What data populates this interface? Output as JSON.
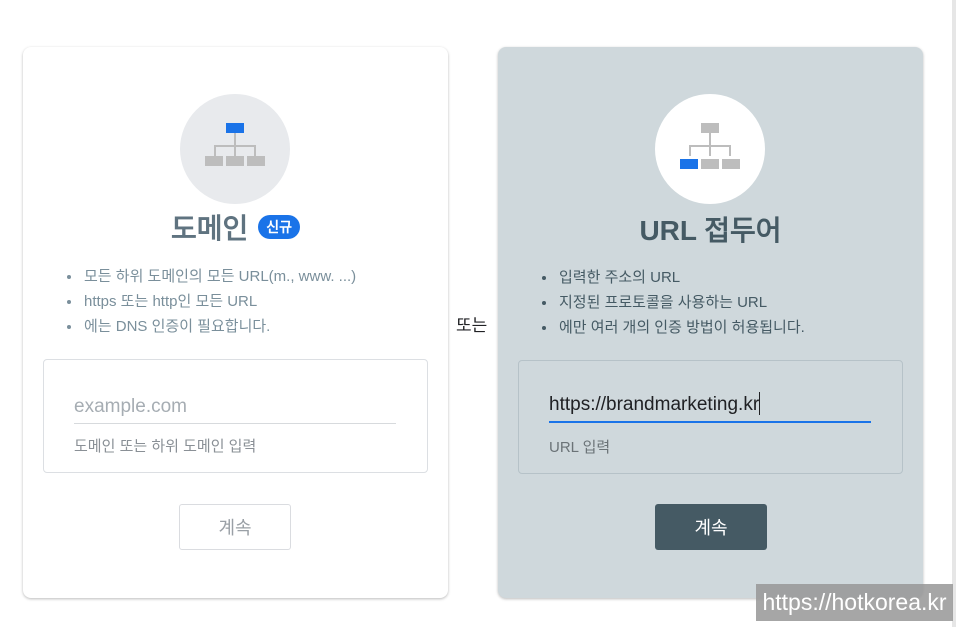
{
  "domain_card": {
    "title": "도메인",
    "badge": "신규",
    "bullets": [
      "모든 하위 도메인의 모든 URL(m., www. ...)",
      "https 또는 http인 모든 URL",
      "에는 DNS 인증이 필요합니다."
    ],
    "input": {
      "placeholder": "example.com",
      "value": "",
      "helper": "도메인 또는 하위 도메인 입력"
    },
    "continue_label": "계속",
    "icon": "sitemap-icon"
  },
  "separator": {
    "label": "또는"
  },
  "url_card": {
    "title": "URL 접두어",
    "bullets": [
      "입력한 주소의 URL",
      "지정된 프로토콜을 사용하는 URL",
      "에만 여러 개의 인증 방법이 허용됩니다."
    ],
    "input": {
      "placeholder": "",
      "value": "https://brandmarketing.kr",
      "helper": "URL 입력"
    },
    "continue_label": "계속",
    "icon": "sitemap-icon"
  },
  "watermark": {
    "text": "https://hotkorea.kr"
  },
  "colors": {
    "accent_blue": "#1a73e8",
    "url_card_bg": "#cfd8dc",
    "primary_button": "#455a64"
  }
}
